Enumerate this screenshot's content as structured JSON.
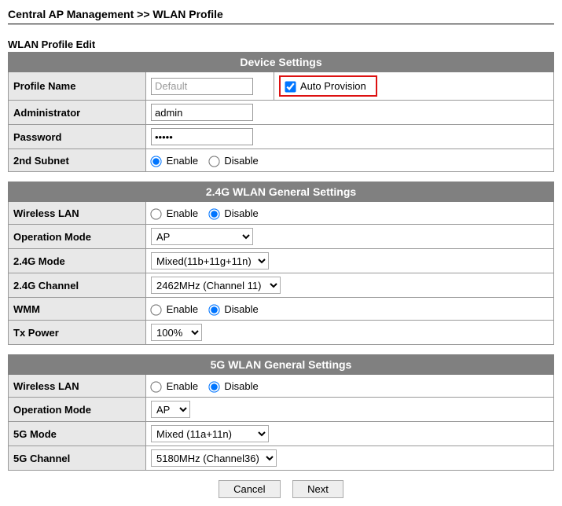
{
  "breadcrumb": "Central AP Management >> WLAN Profile",
  "section_title": "WLAN Profile Edit",
  "device_settings": {
    "header": "Device Settings",
    "profile_name_label": "Profile Name",
    "profile_name_placeholder": "Default",
    "profile_name_value": "",
    "auto_provision_label": "Auto Provision",
    "auto_provision_checked": true,
    "administrator_label": "Administrator",
    "administrator_value": "admin",
    "password_label": "Password",
    "password_value": "•••••",
    "subnet_label": "2nd Subnet",
    "enable_label": "Enable",
    "disable_label": "Disable",
    "subnet_value": "enable"
  },
  "wlan24": {
    "header": "2.4G WLAN General Settings",
    "wireless_lan_label": "Wireless LAN",
    "wireless_lan_value": "disable",
    "operation_mode_label": "Operation Mode",
    "operation_mode_value": "AP",
    "mode_label": "2.4G Mode",
    "mode_value": "Mixed(11b+11g+11n)",
    "channel_label": "2.4G Channel",
    "channel_value": "2462MHz (Channel 11)",
    "wmm_label": "WMM",
    "wmm_value": "disable",
    "tx_power_label": "Tx Power",
    "tx_power_value": "100%",
    "enable_label": "Enable",
    "disable_label": "Disable"
  },
  "wlan5": {
    "header": "5G WLAN General Settings",
    "wireless_lan_label": "Wireless LAN",
    "wireless_lan_value": "disable",
    "operation_mode_label": "Operation Mode",
    "operation_mode_value": "AP",
    "mode_label": "5G Mode",
    "mode_value": "Mixed (11a+11n)",
    "channel_label": "5G Channel",
    "channel_value": "5180MHz (Channel36)",
    "enable_label": "Enable",
    "disable_label": "Disable"
  },
  "buttons": {
    "cancel": "Cancel",
    "next": "Next"
  }
}
